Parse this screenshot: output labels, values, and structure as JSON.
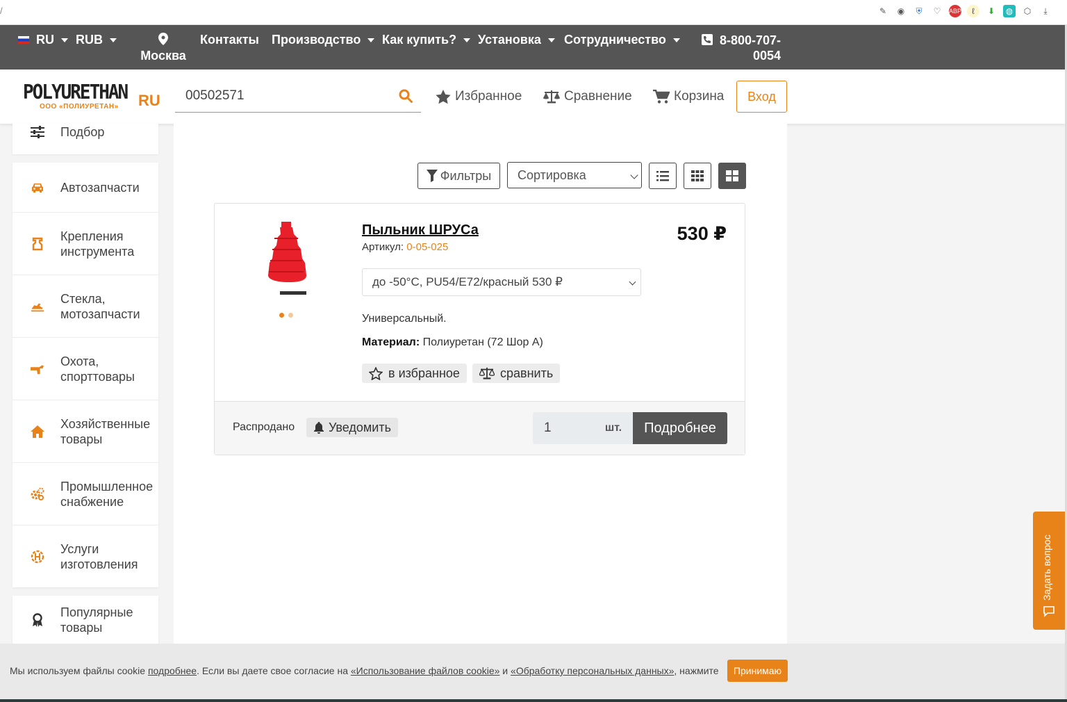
{
  "nav": {
    "lang": "RU",
    "currency": "RUB",
    "city": "Москва",
    "items": [
      "Контакты",
      "Производство",
      "Как купить?",
      "Установка",
      "Сотрудничество"
    ],
    "phone": "8-800-707-0054"
  },
  "header": {
    "logo_word": "POLYURETHAN",
    "logo_sub": "ООО «ПОЛИУРЕТАН»",
    "logo_ru": "RU",
    "search_value": "00502571",
    "favorites": "Избранное",
    "compare": "Сравнение",
    "cart": "Корзина",
    "login": "Вход"
  },
  "sidebar": {
    "top_item": "Подбор",
    "items": [
      {
        "label": "Автозапчасти",
        "icon": "car-icon"
      },
      {
        "label": "Крепления инструмента",
        "icon": "tool-mount-icon"
      },
      {
        "label": "Стекла, мотозапчасти",
        "icon": "snowmobile-icon"
      },
      {
        "label": "Охота, спорттовары",
        "icon": "gun-icon"
      },
      {
        "label": "Хозяйственные товары",
        "icon": "home-icon"
      },
      {
        "label": "Промышленное снабжение",
        "icon": "gears-icon"
      },
      {
        "label": "Услуги изготовления",
        "icon": "manufacturing-icon"
      }
    ],
    "popular": "Популярные товары"
  },
  "toolbar": {
    "filters": "Фильтры",
    "sort": "Сортировка"
  },
  "product": {
    "title": "Пыльник ШРУСа",
    "sku_label": "Артикул:",
    "sku": "0-05-025",
    "price": "530 ₽",
    "variant": "до -50°C, PU54/E72/красный 530 ₽",
    "description": "Универсальный.",
    "material_label": "Материал:",
    "material": "Полиуретан (72 Шор А)",
    "fav_btn": "в избранное",
    "cmp_btn": "сравнить",
    "status": "Распродано",
    "notify": "Уведомить",
    "qty": "1",
    "unit": "шт.",
    "details": "Подробнее"
  },
  "ask_tab": "Задать вопрос",
  "cookie": {
    "part1": "Мы используем файлы cookie ",
    "link1": "подробнее",
    "part2": ". Если вы даете свое согласие на ",
    "link2": "«Использование файлов cookie»",
    "part3": " и ",
    "link3": "«Обработку персональных данных»",
    "part4": ", нажмите",
    "accept": "Принимаю"
  },
  "colors": {
    "accent": "#e8831a",
    "nav_bg": "#555555",
    "product_red": "#e8202a"
  }
}
